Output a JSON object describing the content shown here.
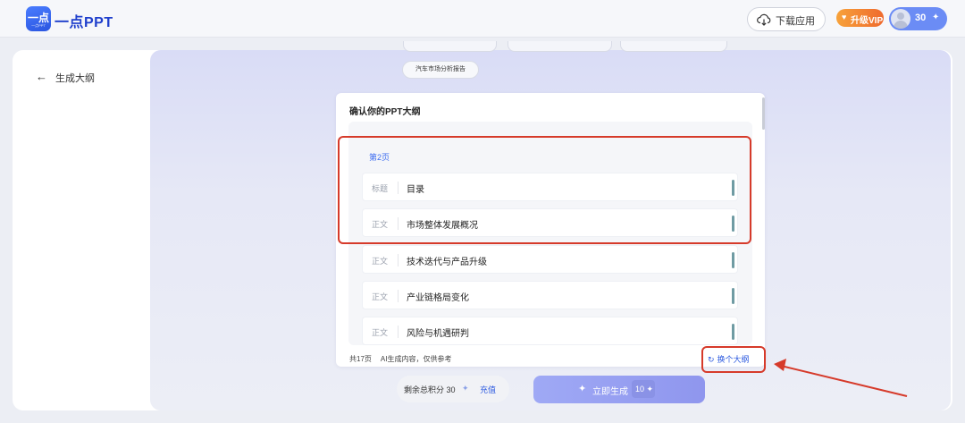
{
  "header": {
    "logo_icon_text": "一点",
    "logo_icon_sub": "一点PPT",
    "logo_text": "一点PPT",
    "download_label": "下载应用",
    "vip_label": "升级VIP",
    "points": "30"
  },
  "sidebar": {
    "back_label": "生成大纲"
  },
  "topic_chip": "汽车市场分析报告",
  "card": {
    "title": "确认你的PPT大纲",
    "page_label": "第2页",
    "rows": [
      {
        "tag": "标题",
        "text": "目录"
      },
      {
        "tag": "正文",
        "text": "市场整体发展概况"
      },
      {
        "tag": "正文",
        "text": "技术迭代与产品升级"
      },
      {
        "tag": "正文",
        "text": "产业链格局变化"
      },
      {
        "tag": "正文",
        "text": "风险与机遇研判"
      }
    ],
    "footer_pages": "共17页",
    "footer_note": "AI生成内容，仅供参考",
    "swap_label": "换个大纲"
  },
  "bottom": {
    "credits_label": "剩余总积分 30",
    "recharge_label": "充值",
    "generate_label": "立即生成",
    "generate_cost": "10"
  },
  "colors": {
    "brand_blue": "#2f5ce0",
    "annotation_red": "#d63a2a",
    "vip_orange": "#f08a33"
  },
  "icons": {
    "download": "cloud-download-icon",
    "back": "arrow-left-icon",
    "swap": "refresh-icon",
    "sparkle": "sparkle-icon",
    "diamond": "diamond-icon"
  }
}
